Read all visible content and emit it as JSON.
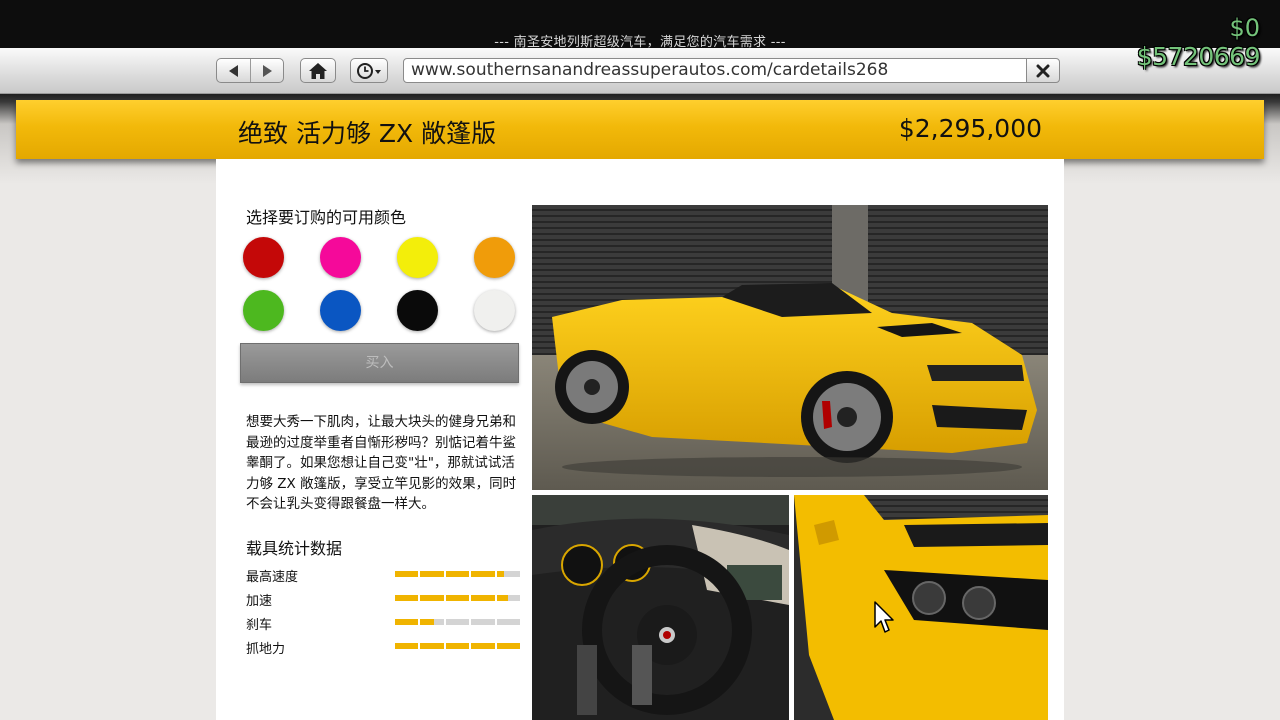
{
  "window": {
    "title": "--- 南圣安地列斯超级汽车，满足您的汽车需求 ---"
  },
  "toolbar": {
    "back_icon": "back-arrow-icon",
    "forward_icon": "forward-arrow-icon",
    "home_icon": "home-icon",
    "history_icon": "clock-history-icon",
    "url": "www.southernsanandreassuperautos.com/cardetails268",
    "close_icon": "close-x-icon"
  },
  "hud": {
    "cash": "$0",
    "bank": "$5720669",
    "color": "#74c37a"
  },
  "vehicle": {
    "name": "绝致 活力够 ZX 敞篷版",
    "price": "$2,295,000"
  },
  "colors": {
    "heading": "选择要订购的可用颜色",
    "swatches": [
      {
        "name": "red",
        "hex": "#c40808"
      },
      {
        "name": "pink",
        "hex": "#f5099a"
      },
      {
        "name": "yellow",
        "hex": "#f3ee0a"
      },
      {
        "name": "orange",
        "hex": "#f09c0a"
      },
      {
        "name": "green",
        "hex": "#4db81f"
      },
      {
        "name": "blue",
        "hex": "#0a56c2"
      },
      {
        "name": "black",
        "hex": "#0a0a0a"
      },
      {
        "name": "white",
        "hex": "#f0f0ee"
      }
    ]
  },
  "buy_button": {
    "label": "买入"
  },
  "description": "想要大秀一下肌肉，让最大块头的健身兄弟和最逊的过度举重者自惭形秽吗？别惦记着牛鲨睾酮了。如果您想让自己变\"壮\"，那就试试活力够 ZX 敞篷版，享受立竿见影的效果，同时不会让乳头变得跟餐盘一样大。",
  "stats": {
    "heading": "载具统计数据",
    "items": [
      {
        "label": "最高速度",
        "value": 0.86
      },
      {
        "label": "加速",
        "value": 0.9
      },
      {
        "label": "刹车",
        "value": 0.32
      },
      {
        "label": "抓地力",
        "value": 1.0
      }
    ],
    "bar_color": "#f0b400"
  },
  "gallery": {
    "photos": [
      "car-side-photo",
      "interior-photo",
      "headlight-photo"
    ]
  }
}
